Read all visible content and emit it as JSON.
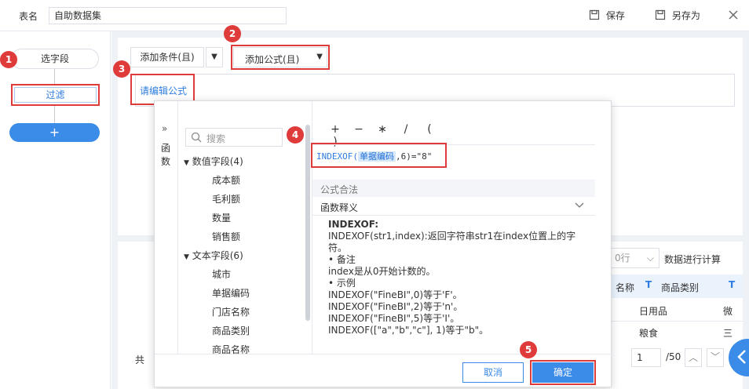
{
  "header": {
    "table_name_label": "表名",
    "table_name_value": "自助数据集",
    "save_label": "保存",
    "save_as_label": "另存为"
  },
  "left": {
    "select_fields": "选字段",
    "filter": "过滤",
    "add": "+"
  },
  "toolbar": {
    "add_condition": "添加条件(且)",
    "add_formula": "添加公式(且)",
    "edit_formula": "请编辑公式"
  },
  "background": {
    "rows_fragment": "0行",
    "compute_text": "数据进行计算",
    "col1": "名称",
    "col2": "商品类别",
    "cell1": "日用品",
    "cell2": "微",
    "cell3": "粮食",
    "cell4": "三",
    "footer_char": "共",
    "page_value": "1",
    "page_total": "/50"
  },
  "dialog": {
    "side_tab": "函数",
    "search_placeholder": "搜索",
    "numeric_group": "数值字段(4)",
    "numeric_fields": [
      "成本额",
      "毛利额",
      "数量",
      "销售额"
    ],
    "text_group": "文本字段(6)",
    "text_fields": [
      "城市",
      "单据编码",
      "门店名称",
      "商品类别",
      "商品名称"
    ],
    "operators": [
      "+",
      "−",
      "∗",
      "/",
      "(",
      ")"
    ],
    "formula": {
      "prefix": "INDEXOF(",
      "field": "单据编码",
      "suffix": ",6)=\"8\""
    },
    "valid_text": "公式合法",
    "func_desc_title": "函数释义",
    "desc": {
      "name": "INDEXOF:",
      "line1": "INDEXOF(str1,index):返回字符串str1在index位置上的字",
      "line2": "符。",
      "note_title": "• 备注",
      "note": "index是从0开始计数的。",
      "example_title": "• 示例",
      "ex1": "INDEXOF(\"FineBI\",0)等于'F'。",
      "ex2": "INDEXOF(\"FineBI\",2)等于'n'。",
      "ex3": "INDEXOF(\"FineBI\",5)等于'I'。",
      "ex4": "INDEXOF([\"a\",\"b\",\"c\"], 1)等于\"b\"。"
    },
    "cancel": "取消",
    "confirm": "确定"
  },
  "badges": [
    "1",
    "2",
    "3",
    "4",
    "5"
  ],
  "colors": {
    "accent": "#2f7de1",
    "callout": "#e03b3b",
    "background": "#eef1f5"
  }
}
